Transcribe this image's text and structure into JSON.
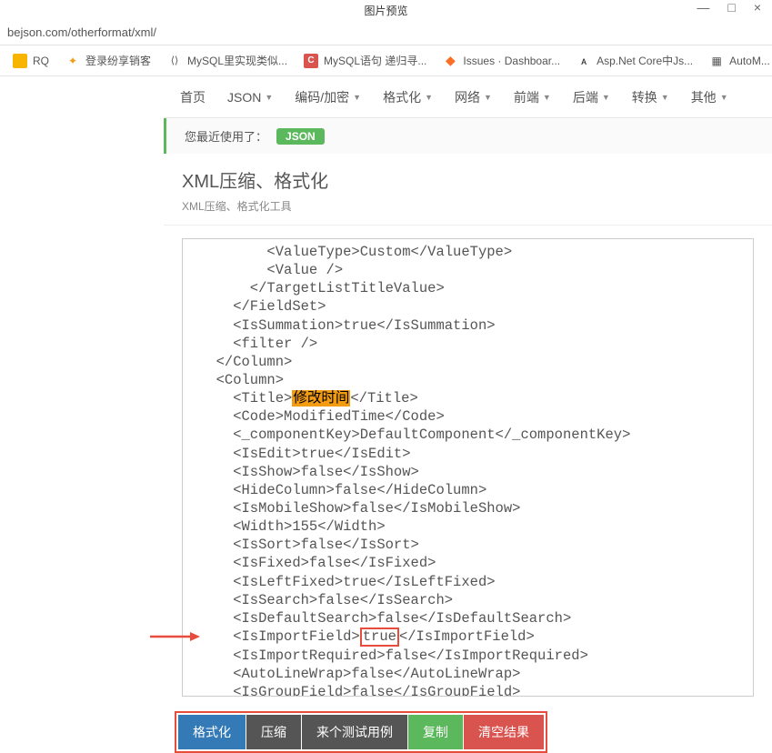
{
  "window": {
    "title": "图片预览",
    "minimize": "—",
    "maximize": "□",
    "close": "×"
  },
  "address": "bejson.com/otherformat/xml/",
  "bookmarks": [
    {
      "label": "RQ",
      "icon": "yellow"
    },
    {
      "label": "登录纷享销客",
      "icon": "orange"
    },
    {
      "label": "MySQL里实现类似...",
      "icon": "brackets"
    },
    {
      "label": "MySQL语句 递归寻...",
      "icon": "red-c"
    },
    {
      "label": "Issues · Dashboar...",
      "icon": "gitlab"
    },
    {
      "label": "Asp.Net Core中Js...",
      "icon": "dark-a"
    },
    {
      "label": "AutoM...",
      "icon": "dark-logo"
    }
  ],
  "nav": {
    "items": [
      "首页",
      "JSON",
      "编码/加密",
      "格式化",
      "网络",
      "前端",
      "后端",
      "转换",
      "其他"
    ]
  },
  "recent": {
    "label": "您最近使用了：",
    "badge": "JSON"
  },
  "header": {
    "title": "XML压缩、格式化",
    "subtitle": "XML压缩、格式化工具"
  },
  "xml": {
    "lines": [
      {
        "indent": 4,
        "text": "<ValueType>Custom</ValueType>"
      },
      {
        "indent": 4,
        "text": "<Value />"
      },
      {
        "indent": 3,
        "text": "</TargetListTitleValue>"
      },
      {
        "indent": 2,
        "text": "</FieldSet>"
      },
      {
        "indent": 2,
        "text": "<IsSummation>true</IsSummation>"
      },
      {
        "indent": 2,
        "text": "<filter />"
      },
      {
        "indent": 1,
        "text": "</Column>"
      },
      {
        "indent": 1,
        "text": "<Column>"
      },
      {
        "indent": 2,
        "pre": "<Title>",
        "highlight": "修改时间",
        "post": "</Title>",
        "highlightType": "orange"
      },
      {
        "indent": 2,
        "text": "<Code>ModifiedTime</Code>"
      },
      {
        "indent": 2,
        "text": "<_componentKey>DefaultComponent</_componentKey>"
      },
      {
        "indent": 2,
        "text": "<IsEdit>true</IsEdit>"
      },
      {
        "indent": 2,
        "text": "<IsShow>false</IsShow>"
      },
      {
        "indent": 2,
        "text": "<HideColumn>false</HideColumn>"
      },
      {
        "indent": 2,
        "text": "<IsMobileShow>false</IsMobileShow>"
      },
      {
        "indent": 2,
        "text": "<Width>155</Width>"
      },
      {
        "indent": 2,
        "text": "<IsSort>false</IsSort>"
      },
      {
        "indent": 2,
        "text": "<IsFixed>false</IsFixed>"
      },
      {
        "indent": 2,
        "text": "<IsLeftFixed>true</IsLeftFixed>"
      },
      {
        "indent": 2,
        "text": "<IsSearch>false</IsSearch>"
      },
      {
        "indent": 2,
        "text": "<IsDefaultSearch>false</IsDefaultSearch>"
      },
      {
        "indent": 2,
        "pre": "<IsImportField>",
        "highlight": "true",
        "post": "</IsImportField>",
        "highlightType": "redbox",
        "arrow": true
      },
      {
        "indent": 2,
        "text": "<IsImportRequired>false</IsImportRequired>"
      },
      {
        "indent": 2,
        "text": "<AutoLineWrap>false</AutoLineWrap>"
      },
      {
        "indent": 2,
        "text": "<IsGroupField>false</IsGroupField>"
      }
    ]
  },
  "buttons": {
    "format": "格式化",
    "compress": "压缩",
    "sample": "来个测试用例",
    "copy": "复制",
    "clear": "清空结果"
  }
}
